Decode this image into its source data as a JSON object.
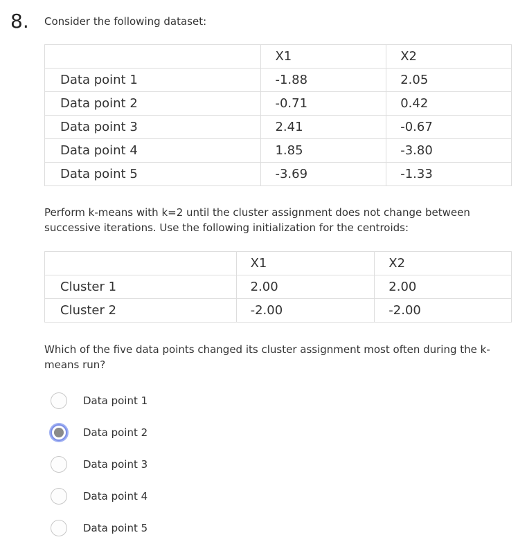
{
  "question": {
    "number": "8.",
    "prompt": "Consider the following dataset:",
    "instruction": "Perform k-means with k=2 until the cluster assignment does not change between successive iterations. Use the following initialization for the centroids:",
    "ask": "Which of the five data points changed its cluster assignment most often during the k-means run?"
  },
  "dataset": {
    "headers": [
      "",
      "X1",
      "X2"
    ],
    "rows": [
      [
        "Data point 1",
        "-1.88",
        "2.05"
      ],
      [
        "Data point 2",
        "-0.71",
        "0.42"
      ],
      [
        "Data point 3",
        "2.41",
        "-0.67"
      ],
      [
        "Data point 4",
        "1.85",
        "-3.80"
      ],
      [
        "Data point 5",
        "-3.69",
        "-1.33"
      ]
    ]
  },
  "centroids": {
    "headers": [
      "",
      "X1",
      "X2"
    ],
    "rows": [
      [
        "Cluster 1",
        "2.00",
        "2.00"
      ],
      [
        "Cluster 2",
        "-2.00",
        "-2.00"
      ]
    ]
  },
  "options": [
    {
      "label": "Data point 1",
      "selected": false
    },
    {
      "label": "Data point 2",
      "selected": true
    },
    {
      "label": "Data point 3",
      "selected": false
    },
    {
      "label": "Data point 4",
      "selected": false
    },
    {
      "label": "Data point 5",
      "selected": false
    }
  ]
}
